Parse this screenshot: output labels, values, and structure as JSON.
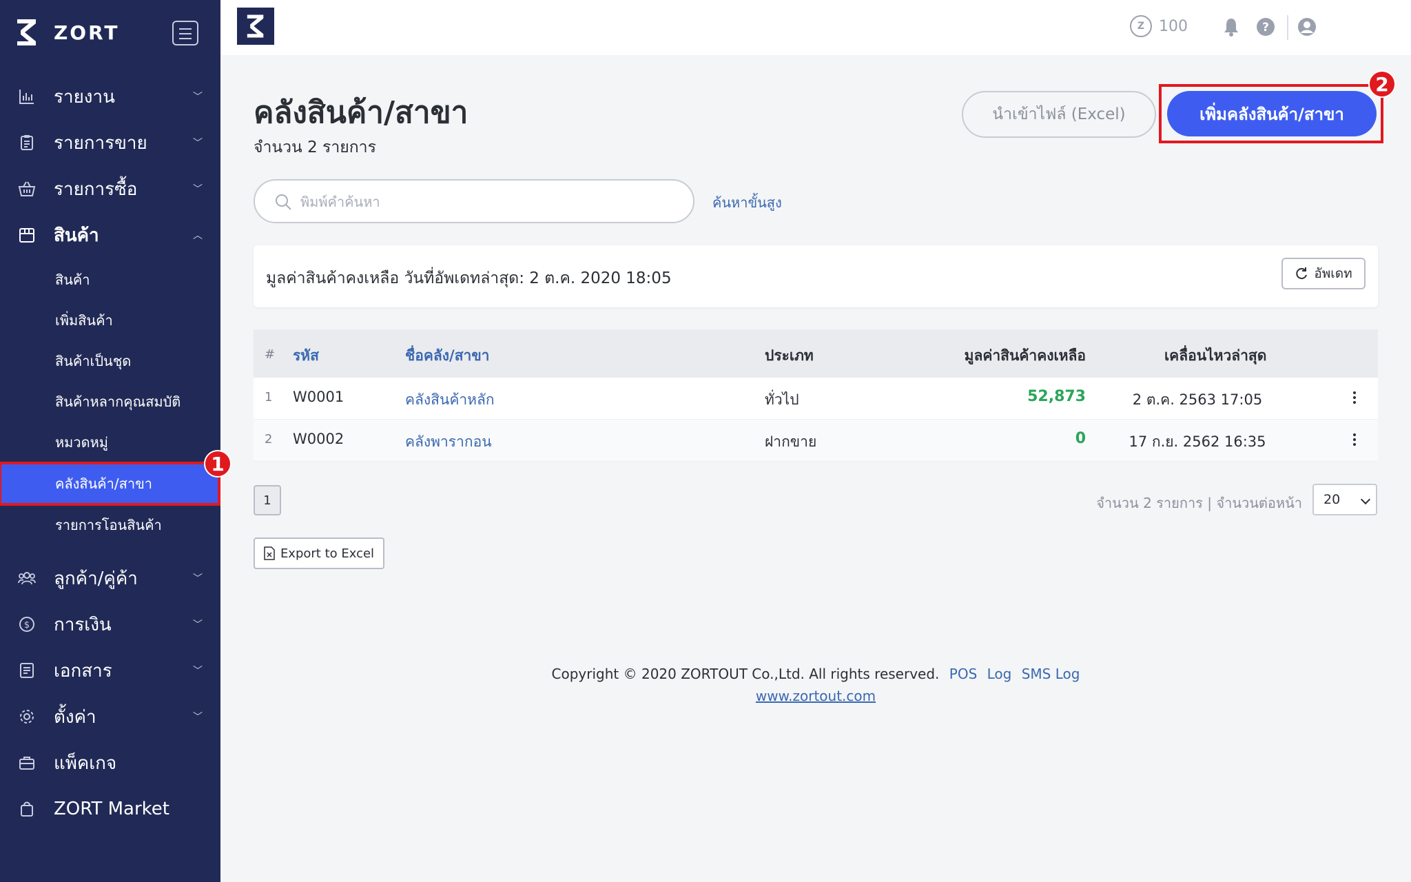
{
  "sidebar": {
    "brand": "ZORT",
    "menu": [
      {
        "label": "รายงาน",
        "icon": "bar-chart-icon"
      },
      {
        "label": "รายการขาย",
        "icon": "clipboard-icon"
      },
      {
        "label": "รายการซื้อ",
        "icon": "basket-icon"
      },
      {
        "label": "สินค้า",
        "icon": "box-icon"
      },
      {
        "label": "ลูกค้า/คู่ค้า",
        "icon": "users-icon"
      },
      {
        "label": "การเงิน",
        "icon": "dollar-icon"
      },
      {
        "label": "เอกสาร",
        "icon": "document-icon"
      },
      {
        "label": "ตั้งค่า",
        "icon": "gear-icon"
      },
      {
        "label": "แพ็คเกจ",
        "icon": "briefcase-icon"
      },
      {
        "label": "ZORT Market",
        "icon": "shopping-bag-icon"
      }
    ],
    "submenu": [
      {
        "label": "สินค้า"
      },
      {
        "label": "เพิ่มสินค้า"
      },
      {
        "label": "สินค้าเป็นชุด"
      },
      {
        "label": "สินค้าหลากคุณสมบัติ"
      },
      {
        "label": "หมวดหมู่"
      },
      {
        "label": "คลังสินค้า/สาขา"
      },
      {
        "label": "รายการโอนสินค้า"
      }
    ],
    "annotation_1": "1"
  },
  "topbar": {
    "credits": "100"
  },
  "page": {
    "title": "คลังสินค้า/สาขา",
    "count": "จำนวน 2 รายการ",
    "import_button": "นำเข้าไฟล์ (Excel)",
    "add_button": "เพิ่มคลังสินค้า/สาขา",
    "annotation_2": "2",
    "search_placeholder": "พิมพ์คำค้นหา",
    "advanced_search": "ค้นหาขั้นสูง",
    "stock_value_text": "มูลค่าสินค้าคงเหลือ วันที่อัพเดทล่าสุด: 2 ต.ค. 2020 18:05",
    "update_button": "อัพเดท"
  },
  "table": {
    "headers": {
      "num": "#",
      "code": "รหัส",
      "name": "ชื่อคลัง/สาขา",
      "type": "ประเภท",
      "value": "มูลค่าสินค้าคงเหลือ",
      "movement": "เคลื่อนไหวล่าสุด"
    },
    "rows": [
      {
        "num": "1",
        "code": "W0001",
        "name": "คลังสินค้าหลัก",
        "type": "ทั่วไป",
        "value": "52,873",
        "movement": "2 ต.ค. 2563 17:05"
      },
      {
        "num": "2",
        "code": "W0002",
        "name": "คลังพารากอน",
        "type": "ฝากขาย",
        "value": "0",
        "movement": "17 ก.ย. 2562 16:35"
      }
    ]
  },
  "pagination": {
    "current_page": "1",
    "info": "จำนวน 2 รายการ | จำนวนต่อหน้า",
    "per_page": "20"
  },
  "export_button": "Export to Excel",
  "footer": {
    "copyright": "Copyright © 2020 ZORTOUT Co.,Ltd. All rights reserved.",
    "links": [
      "POS",
      "Log",
      "SMS Log"
    ],
    "website": "www.zortout.com"
  },
  "colors": {
    "sidebar_bg": "#212a56",
    "accent": "#3e5df0",
    "annotation": "#e0191f",
    "positive": "#2ba55a",
    "link": "#3a68b0"
  }
}
